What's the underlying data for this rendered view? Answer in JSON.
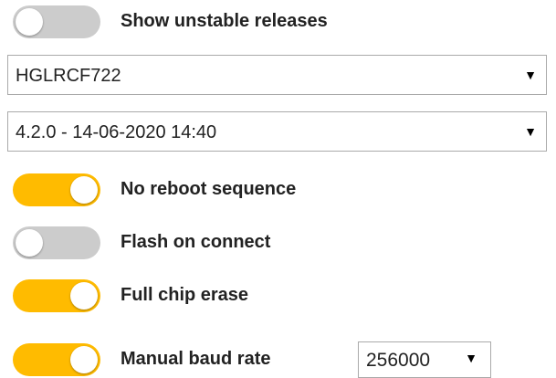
{
  "toggles": [
    {
      "label": "Show unstable releases",
      "state": "off"
    },
    {
      "label": "No reboot sequence",
      "state": "on"
    },
    {
      "label": "Flash on connect",
      "state": "off"
    },
    {
      "label": "Full chip erase",
      "state": "on"
    },
    {
      "label": "Manual baud rate",
      "state": "on"
    }
  ],
  "board_select": {
    "value": "HGLRCF722",
    "caret": "▼"
  },
  "firmware_select": {
    "value": "4.2.0 - 14-06-2020 14:40",
    "caret": "▼"
  },
  "baud_select": {
    "value": "256000",
    "caret": "▼"
  },
  "colors": {
    "on": "#ffbb00",
    "off": "#cccccc"
  }
}
